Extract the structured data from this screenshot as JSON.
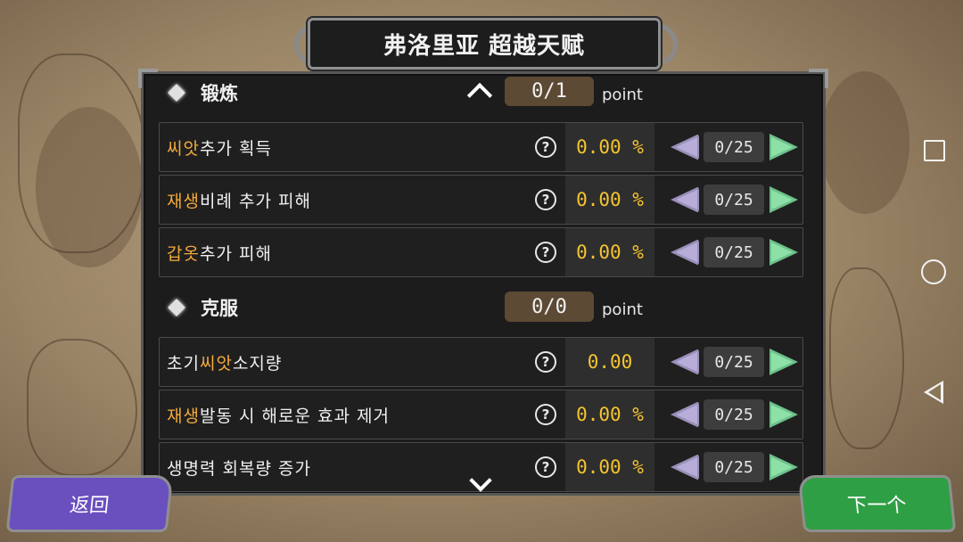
{
  "title": "弗洛里亚 超越天赋",
  "colors": {
    "highlight": "#f4a93b",
    "value": "#f5c431",
    "back": "#6a4fbf",
    "next": "#2f9f45"
  },
  "sections": [
    {
      "title": "锻炼",
      "points": "0/1",
      "point_unit": "point",
      "rows": [
        {
          "hl": "씨앗",
          "rest": " 추가 획득",
          "value": "0.00 %",
          "count": "0/25"
        },
        {
          "hl": "재생",
          "rest": " 비례 추가 피해",
          "value": "0.00 %",
          "count": "0/25"
        },
        {
          "hl": "갑옷",
          "rest": " 추가 피해",
          "value": "0.00 %",
          "count": "0/25"
        }
      ]
    },
    {
      "title": "克服",
      "points": "0/0",
      "point_unit": "point",
      "rows": [
        {
          "pre": "초기 ",
          "hl": "씨앗",
          "rest": " 소지량",
          "value": "0.00",
          "count": "0/25"
        },
        {
          "hl": "재생",
          "rest": " 발동 시 해로운 효과 제거",
          "value": "0.00 %",
          "count": "0/25"
        },
        {
          "pre": "생명력 회복량 증가",
          "value": "0.00 %",
          "count": "0/25"
        }
      ]
    }
  ],
  "buttons": {
    "back": "返回",
    "next": "下一个"
  },
  "icons": {
    "help": "?",
    "scroll_up": "chevron-up-icon",
    "scroll_down": "chevron-down-icon",
    "decrease": "arrow-left-icon",
    "increase": "arrow-right-icon",
    "section_marker": "diamond-icon"
  },
  "system_nav": [
    "recents-button",
    "home-button",
    "back-button"
  ]
}
